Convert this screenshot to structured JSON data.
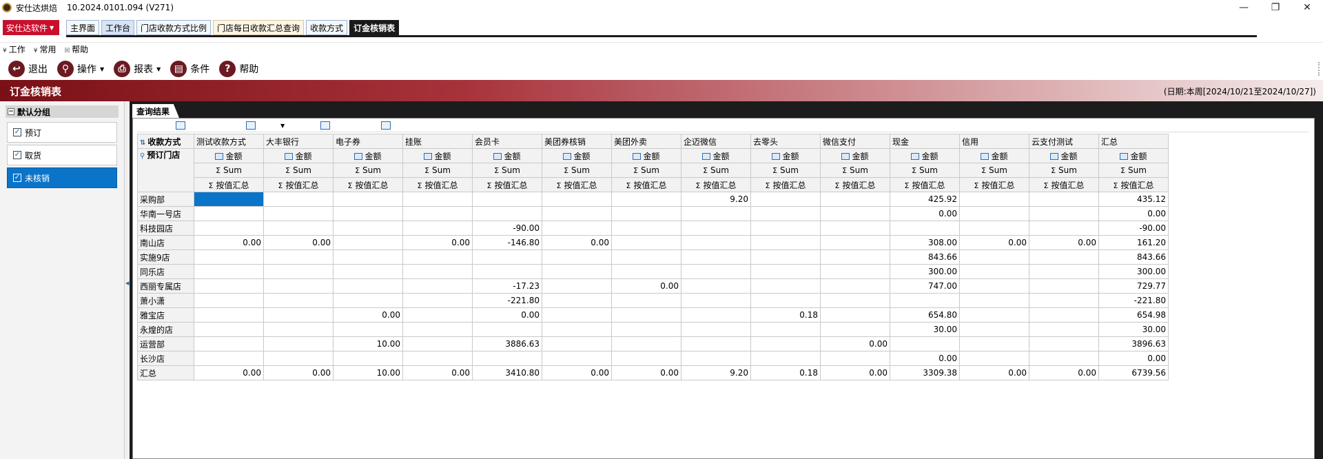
{
  "window": {
    "title": "安仕达烘焙",
    "version": "10.2024.0101.094 (V271)",
    "controls": [
      "—",
      "❐",
      "✕"
    ]
  },
  "brand_button": "安仕达软件",
  "tabs": [
    {
      "label": "主界面",
      "style": "plain"
    },
    {
      "label": "工作台",
      "style": "blue"
    },
    {
      "label": "门店收款方式比例",
      "style": "plain"
    },
    {
      "label": "门店每日收款汇总查询",
      "style": "pale"
    },
    {
      "label": "收款方式",
      "style": "plain"
    },
    {
      "label": "订金核销表",
      "style": "active"
    }
  ],
  "menu": [
    {
      "label": "工作",
      "mark": "¥"
    },
    {
      "label": "常用",
      "mark": "¥"
    },
    {
      "label": "帮助",
      "mark": "ℍ"
    }
  ],
  "toolbar": [
    {
      "label": "退出",
      "icon": "exit-icon",
      "glyph": "↩",
      "caret": false
    },
    {
      "label": "操作",
      "icon": "search-icon",
      "glyph": "⚲",
      "caret": true
    },
    {
      "label": "报表",
      "icon": "print-icon",
      "glyph": "⎙",
      "caret": true
    },
    {
      "label": "条件",
      "icon": "filter-icon",
      "glyph": "▤",
      "caret": false
    },
    {
      "label": "帮助",
      "icon": "help-icon",
      "glyph": "?",
      "caret": false
    }
  ],
  "report": {
    "title": "订金核销表",
    "date_range": "(日期:本周[2024/10/21至2024/10/27])"
  },
  "left_panel": {
    "group_title": "默认分组",
    "items": [
      {
        "label": "预订",
        "checked": true,
        "selected": false
      },
      {
        "label": "取货",
        "checked": true,
        "selected": false
      },
      {
        "label": "未核销",
        "checked": true,
        "selected": true
      }
    ]
  },
  "results": {
    "tab_label": "查询结果",
    "column_field": "收款方式",
    "row_field": "预订门店",
    "measure_label": "金额",
    "sum_label": "Sum",
    "total_label": "按值汇总",
    "columns": [
      "测试收款方式",
      "大丰银行",
      "电子券",
      "挂账",
      "会员卡",
      "美团券核销",
      "美团外卖",
      "企迈微信",
      "去零头",
      "微信支付",
      "现金",
      "信用",
      "云支付测试",
      "汇总"
    ],
    "rows": [
      {
        "name": "采购部",
        "values": [
          "",
          "",
          "",
          "",
          "",
          "",
          "",
          "9.20",
          "",
          "",
          "425.92",
          "",
          "",
          "435.12"
        ]
      },
      {
        "name": "华南一号店",
        "values": [
          "",
          "",
          "",
          "",
          "",
          "",
          "",
          "",
          "",
          "",
          "0.00",
          "",
          "",
          "0.00"
        ]
      },
      {
        "name": "科技园店",
        "values": [
          "",
          "",
          "",
          "",
          "-90.00",
          "",
          "",
          "",
          "",
          "",
          "",
          "",
          "",
          "-90.00"
        ]
      },
      {
        "name": "南山店",
        "values": [
          "0.00",
          "0.00",
          "",
          "0.00",
          "-146.80",
          "0.00",
          "",
          "",
          "",
          "",
          "308.00",
          "0.00",
          "0.00",
          "161.20"
        ]
      },
      {
        "name": "实施9店",
        "values": [
          "",
          "",
          "",
          "",
          "",
          "",
          "",
          "",
          "",
          "",
          "843.66",
          "",
          "",
          "843.66"
        ]
      },
      {
        "name": "同乐店",
        "values": [
          "",
          "",
          "",
          "",
          "",
          "",
          "",
          "",
          "",
          "",
          "300.00",
          "",
          "",
          "300.00"
        ]
      },
      {
        "name": "西丽专属店",
        "values": [
          "",
          "",
          "",
          "",
          "-17.23",
          "",
          "0.00",
          "",
          "",
          "",
          "747.00",
          "",
          "",
          "729.77"
        ]
      },
      {
        "name": "萧小潇",
        "values": [
          "",
          "",
          "",
          "",
          "-221.80",
          "",
          "",
          "",
          "",
          "",
          "",
          "",
          "",
          "-221.80"
        ]
      },
      {
        "name": "雅宝店",
        "values": [
          "",
          "",
          "0.00",
          "",
          "0.00",
          "",
          "",
          "",
          "0.18",
          "",
          "654.80",
          "",
          "",
          "654.98"
        ]
      },
      {
        "name": "永煌的店",
        "values": [
          "",
          "",
          "",
          "",
          "",
          "",
          "",
          "",
          "",
          "",
          "30.00",
          "",
          "",
          "30.00"
        ]
      },
      {
        "name": "运营部",
        "values": [
          "",
          "",
          "10.00",
          "",
          "3886.63",
          "",
          "",
          "",
          "",
          "0.00",
          "",
          "",
          "",
          "3896.63"
        ]
      },
      {
        "name": "长沙店",
        "values": [
          "",
          "",
          "",
          "",
          "",
          "",
          "",
          "",
          "",
          "",
          "0.00",
          "",
          "",
          "0.00"
        ]
      },
      {
        "name": "汇总",
        "values": [
          "0.00",
          "0.00",
          "10.00",
          "0.00",
          "3410.80",
          "0.00",
          "0.00",
          "9.20",
          "0.18",
          "0.00",
          "3309.38",
          "0.00",
          "0.00",
          "6739.56"
        ]
      }
    ]
  },
  "colors": {
    "brand_red": "#c8102e",
    "band_dark": "#7a1017",
    "selection_blue": "#0a74c9"
  }
}
